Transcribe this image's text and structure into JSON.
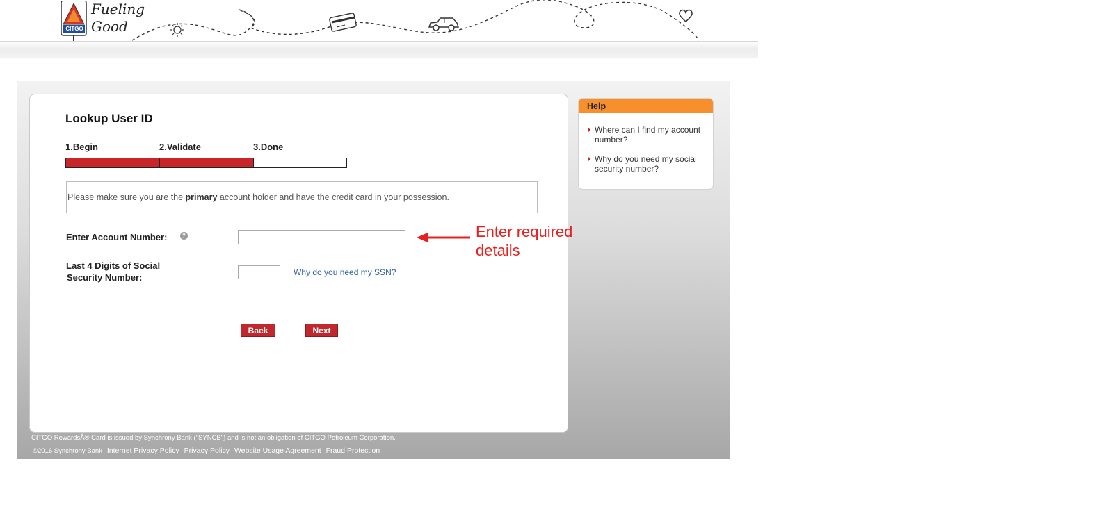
{
  "header": {
    "logo_brand": "CITGO",
    "logo_tagline_1": "Fueling",
    "logo_tagline_2": "Good"
  },
  "page": {
    "title": "Lookup User ID",
    "steps": [
      {
        "label": "1.Begin",
        "complete": true
      },
      {
        "label": "2.Validate",
        "complete": true
      },
      {
        "label": "3.Done",
        "complete": false
      }
    ],
    "progress_color": "#c9262b",
    "notice_before": "Please make sure you are the ",
    "notice_bold": "primary",
    "notice_after": " account holder and have the credit card in your possession.",
    "account_label": "Enter Account Number:",
    "account_help_glyph": "?",
    "account_value": "",
    "ssn_label_line1": "Last 4 Digits of Social",
    "ssn_label_line2": "Security Number:",
    "ssn_value": "",
    "ssn_link": "Why do you need my SSN?",
    "back_label": "Back",
    "next_label": "Next"
  },
  "help": {
    "title": "Help",
    "items": [
      {
        "line1": "Where can I find my account",
        "line2": "number?"
      },
      {
        "line1": "Why do you need my social",
        "line2": "security number?"
      }
    ]
  },
  "footer": {
    "disclaimer": "CITGO RewardsÂ® Card is issued by Synchrony Bank (\"SYNCB\") and is not an obligation of CITGO Petroleum Corporation.",
    "copyright": "©2016 Synchrony Bank",
    "links": [
      "Internet Privacy Policy",
      "Privacy Policy",
      "Website Usage Agreement",
      "Fraud Protection"
    ]
  },
  "annotation": {
    "line1": "Enter required",
    "line2": "details",
    "color": "#e8201f"
  }
}
